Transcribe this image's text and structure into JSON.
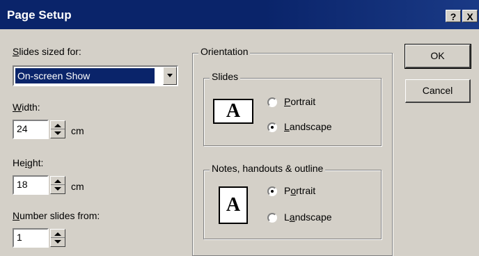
{
  "window": {
    "title": "Page Setup",
    "help_btn": "?",
    "close_btn": "X"
  },
  "slides_sized_for": {
    "label_prefix": "S",
    "label_rest": "lides sized for:",
    "value": "On-screen Show"
  },
  "width": {
    "label_prefix": "W",
    "label_rest": "idth:",
    "value": "24",
    "unit": "cm"
  },
  "height": {
    "label_pre": "He",
    "label_u": "i",
    "label_post": "ght:",
    "value": "18",
    "unit": "cm"
  },
  "number_from": {
    "label_prefix": "N",
    "label_rest": "umber slides from:",
    "value": "1"
  },
  "orientation": {
    "title": "Orientation",
    "slides": {
      "title": "Slides",
      "icon": "A",
      "portrait": {
        "u": "P",
        "rest": "ortrait",
        "selected": false
      },
      "landscape": {
        "u": "L",
        "rest": "andscape",
        "selected": true
      }
    },
    "notes": {
      "title": "Notes, handouts & outline",
      "icon": "A",
      "portrait": {
        "pre": "P",
        "u": "o",
        "rest": "rtrait",
        "selected": true
      },
      "landscape": {
        "pre": "L",
        "u": "a",
        "rest": "ndscape",
        "selected": false
      }
    }
  },
  "buttons": {
    "ok": "OK",
    "cancel": "Cancel"
  }
}
